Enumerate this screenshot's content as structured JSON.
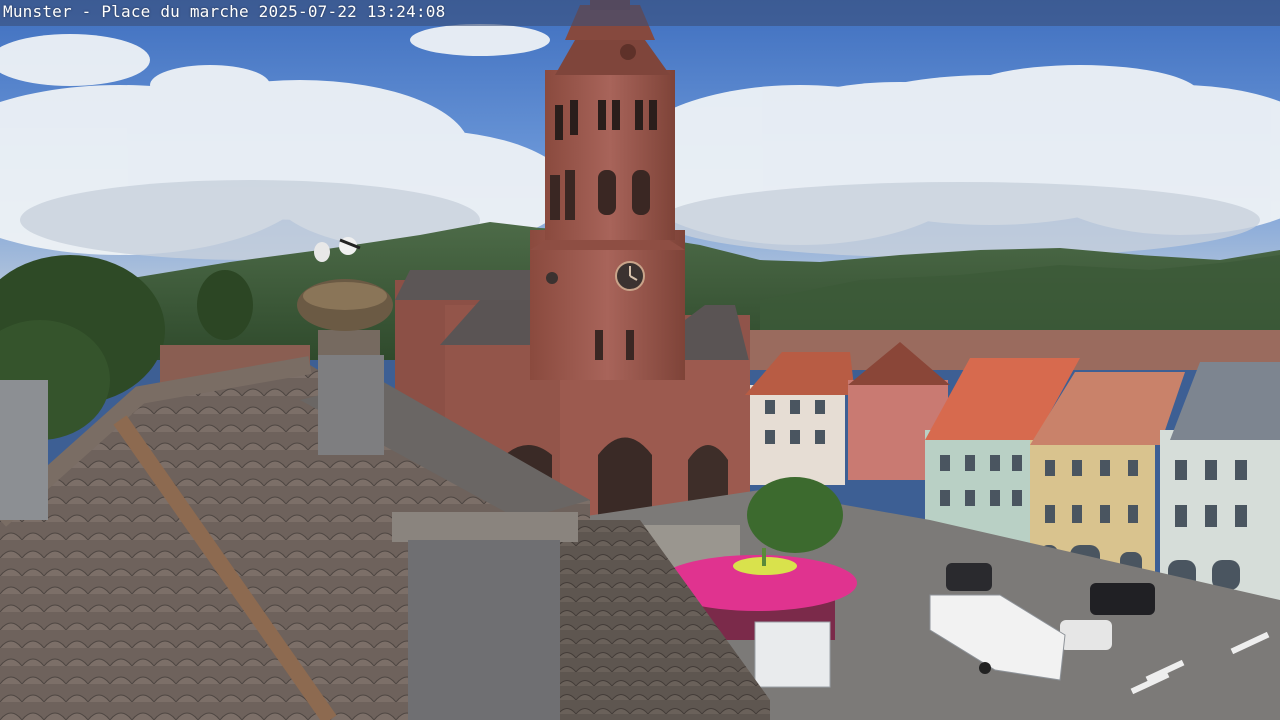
{
  "overlay": {
    "caption": "Munster - Place du marche 2025-07-22 13:24:08"
  },
  "scene": {
    "elements": [
      "sky-with-clouds-panel",
      "forested-mountains",
      "church-bell-tower",
      "stork-nest",
      "tiled-roof-foreground",
      "chimney",
      "town-houses",
      "pink-carousel-umbrella",
      "parked-cars",
      "white-trailer"
    ],
    "colors": {
      "sky": "#4b7dc9",
      "cloud": "#eef2f6",
      "mountain": "#3f5f3a",
      "sandstone": "#9e5a4c",
      "roof_tile": "#6b5f58",
      "carousel": "#e0338f"
    }
  }
}
